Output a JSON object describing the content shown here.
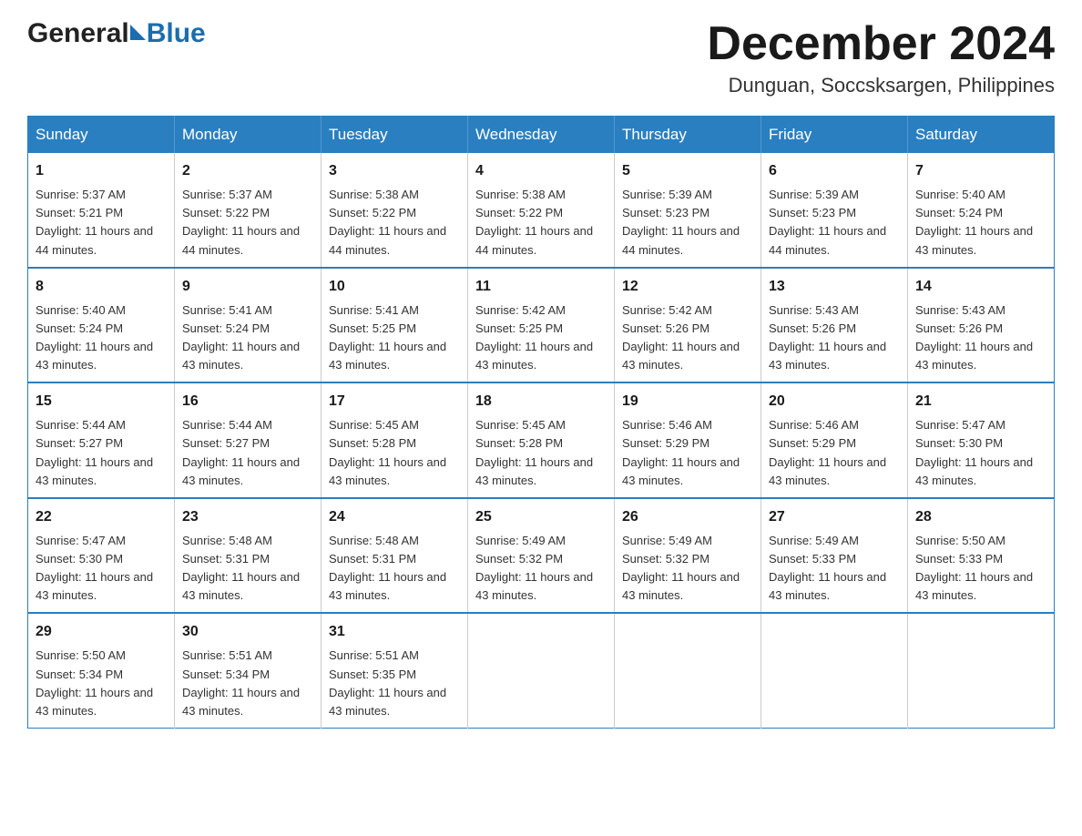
{
  "header": {
    "logo_general": "General",
    "logo_blue": "Blue",
    "month_title": "December 2024",
    "location": "Dunguan, Soccsksargen, Philippines"
  },
  "calendar": {
    "days_of_week": [
      "Sunday",
      "Monday",
      "Tuesday",
      "Wednesday",
      "Thursday",
      "Friday",
      "Saturday"
    ],
    "weeks": [
      [
        {
          "day": "1",
          "sunrise": "Sunrise: 5:37 AM",
          "sunset": "Sunset: 5:21 PM",
          "daylight": "Daylight: 11 hours and 44 minutes."
        },
        {
          "day": "2",
          "sunrise": "Sunrise: 5:37 AM",
          "sunset": "Sunset: 5:22 PM",
          "daylight": "Daylight: 11 hours and 44 minutes."
        },
        {
          "day": "3",
          "sunrise": "Sunrise: 5:38 AM",
          "sunset": "Sunset: 5:22 PM",
          "daylight": "Daylight: 11 hours and 44 minutes."
        },
        {
          "day": "4",
          "sunrise": "Sunrise: 5:38 AM",
          "sunset": "Sunset: 5:22 PM",
          "daylight": "Daylight: 11 hours and 44 minutes."
        },
        {
          "day": "5",
          "sunrise": "Sunrise: 5:39 AM",
          "sunset": "Sunset: 5:23 PM",
          "daylight": "Daylight: 11 hours and 44 minutes."
        },
        {
          "day": "6",
          "sunrise": "Sunrise: 5:39 AM",
          "sunset": "Sunset: 5:23 PM",
          "daylight": "Daylight: 11 hours and 44 minutes."
        },
        {
          "day": "7",
          "sunrise": "Sunrise: 5:40 AM",
          "sunset": "Sunset: 5:24 PM",
          "daylight": "Daylight: 11 hours and 43 minutes."
        }
      ],
      [
        {
          "day": "8",
          "sunrise": "Sunrise: 5:40 AM",
          "sunset": "Sunset: 5:24 PM",
          "daylight": "Daylight: 11 hours and 43 minutes."
        },
        {
          "day": "9",
          "sunrise": "Sunrise: 5:41 AM",
          "sunset": "Sunset: 5:24 PM",
          "daylight": "Daylight: 11 hours and 43 minutes."
        },
        {
          "day": "10",
          "sunrise": "Sunrise: 5:41 AM",
          "sunset": "Sunset: 5:25 PM",
          "daylight": "Daylight: 11 hours and 43 minutes."
        },
        {
          "day": "11",
          "sunrise": "Sunrise: 5:42 AM",
          "sunset": "Sunset: 5:25 PM",
          "daylight": "Daylight: 11 hours and 43 minutes."
        },
        {
          "day": "12",
          "sunrise": "Sunrise: 5:42 AM",
          "sunset": "Sunset: 5:26 PM",
          "daylight": "Daylight: 11 hours and 43 minutes."
        },
        {
          "day": "13",
          "sunrise": "Sunrise: 5:43 AM",
          "sunset": "Sunset: 5:26 PM",
          "daylight": "Daylight: 11 hours and 43 minutes."
        },
        {
          "day": "14",
          "sunrise": "Sunrise: 5:43 AM",
          "sunset": "Sunset: 5:26 PM",
          "daylight": "Daylight: 11 hours and 43 minutes."
        }
      ],
      [
        {
          "day": "15",
          "sunrise": "Sunrise: 5:44 AM",
          "sunset": "Sunset: 5:27 PM",
          "daylight": "Daylight: 11 hours and 43 minutes."
        },
        {
          "day": "16",
          "sunrise": "Sunrise: 5:44 AM",
          "sunset": "Sunset: 5:27 PM",
          "daylight": "Daylight: 11 hours and 43 minutes."
        },
        {
          "day": "17",
          "sunrise": "Sunrise: 5:45 AM",
          "sunset": "Sunset: 5:28 PM",
          "daylight": "Daylight: 11 hours and 43 minutes."
        },
        {
          "day": "18",
          "sunrise": "Sunrise: 5:45 AM",
          "sunset": "Sunset: 5:28 PM",
          "daylight": "Daylight: 11 hours and 43 minutes."
        },
        {
          "day": "19",
          "sunrise": "Sunrise: 5:46 AM",
          "sunset": "Sunset: 5:29 PM",
          "daylight": "Daylight: 11 hours and 43 minutes."
        },
        {
          "day": "20",
          "sunrise": "Sunrise: 5:46 AM",
          "sunset": "Sunset: 5:29 PM",
          "daylight": "Daylight: 11 hours and 43 minutes."
        },
        {
          "day": "21",
          "sunrise": "Sunrise: 5:47 AM",
          "sunset": "Sunset: 5:30 PM",
          "daylight": "Daylight: 11 hours and 43 minutes."
        }
      ],
      [
        {
          "day": "22",
          "sunrise": "Sunrise: 5:47 AM",
          "sunset": "Sunset: 5:30 PM",
          "daylight": "Daylight: 11 hours and 43 minutes."
        },
        {
          "day": "23",
          "sunrise": "Sunrise: 5:48 AM",
          "sunset": "Sunset: 5:31 PM",
          "daylight": "Daylight: 11 hours and 43 minutes."
        },
        {
          "day": "24",
          "sunrise": "Sunrise: 5:48 AM",
          "sunset": "Sunset: 5:31 PM",
          "daylight": "Daylight: 11 hours and 43 minutes."
        },
        {
          "day": "25",
          "sunrise": "Sunrise: 5:49 AM",
          "sunset": "Sunset: 5:32 PM",
          "daylight": "Daylight: 11 hours and 43 minutes."
        },
        {
          "day": "26",
          "sunrise": "Sunrise: 5:49 AM",
          "sunset": "Sunset: 5:32 PM",
          "daylight": "Daylight: 11 hours and 43 minutes."
        },
        {
          "day": "27",
          "sunrise": "Sunrise: 5:49 AM",
          "sunset": "Sunset: 5:33 PM",
          "daylight": "Daylight: 11 hours and 43 minutes."
        },
        {
          "day": "28",
          "sunrise": "Sunrise: 5:50 AM",
          "sunset": "Sunset: 5:33 PM",
          "daylight": "Daylight: 11 hours and 43 minutes."
        }
      ],
      [
        {
          "day": "29",
          "sunrise": "Sunrise: 5:50 AM",
          "sunset": "Sunset: 5:34 PM",
          "daylight": "Daylight: 11 hours and 43 minutes."
        },
        {
          "day": "30",
          "sunrise": "Sunrise: 5:51 AM",
          "sunset": "Sunset: 5:34 PM",
          "daylight": "Daylight: 11 hours and 43 minutes."
        },
        {
          "day": "31",
          "sunrise": "Sunrise: 5:51 AM",
          "sunset": "Sunset: 5:35 PM",
          "daylight": "Daylight: 11 hours and 43 minutes."
        },
        null,
        null,
        null,
        null
      ]
    ]
  }
}
